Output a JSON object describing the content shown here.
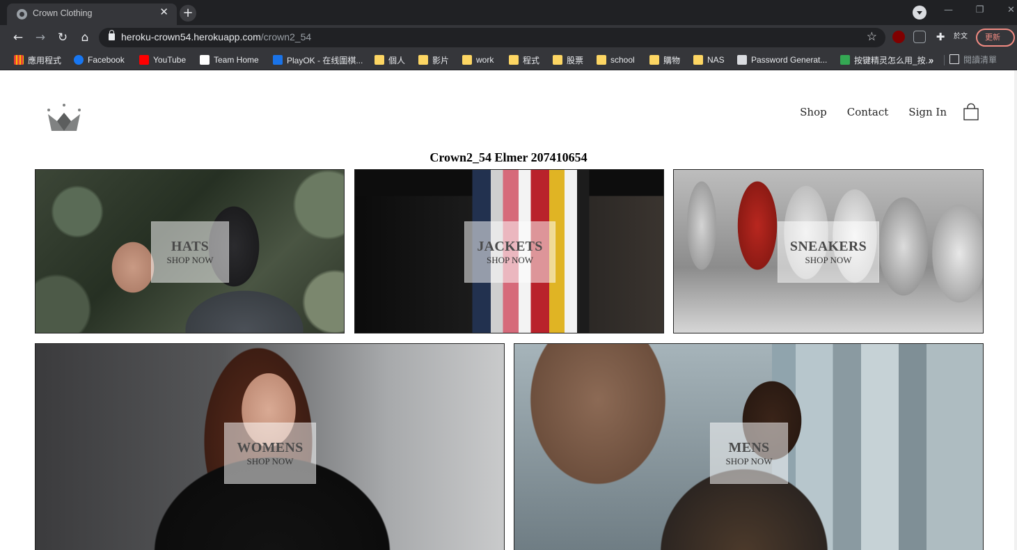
{
  "browser": {
    "tab_title": "Crown Clothing",
    "tab_close": "✕",
    "new_tab": "+",
    "url_domain": "heroku-crown54.herokuapp.com",
    "url_path": "/crown2_54",
    "update_button": "更新",
    "bookmarks": [
      {
        "label": "應用程式",
        "icon": "apps-icon"
      },
      {
        "label": "Facebook",
        "icon": "facebook-icon"
      },
      {
        "label": "YouTube",
        "icon": "youtube-icon"
      },
      {
        "label": "Team Home",
        "icon": "notion-icon"
      },
      {
        "label": "PlayOK - 在线圍棋...",
        "icon": "playok-icon"
      },
      {
        "label": "個人",
        "icon": "folder-icon"
      },
      {
        "label": "影片",
        "icon": "folder-icon"
      },
      {
        "label": "work",
        "icon": "folder-icon"
      },
      {
        "label": "程式",
        "icon": "folder-icon"
      },
      {
        "label": "股票",
        "icon": "folder-icon"
      },
      {
        "label": "school",
        "icon": "folder-icon"
      },
      {
        "label": "購物",
        "icon": "folder-icon"
      },
      {
        "label": "NAS",
        "icon": "folder-icon"
      },
      {
        "label": "Password Generat...",
        "icon": "page-icon"
      },
      {
        "label": "按键精灵怎么用_按...",
        "icon": "page-icon"
      }
    ],
    "bookmarks_more": "»",
    "reading_list_label": "閱讀清單"
  },
  "header": {
    "nav": {
      "shop": "Shop",
      "contact": "Contact",
      "sign_in": "Sign In"
    }
  },
  "page_title": "Crown2_54 Elmer 207410654",
  "categories": [
    {
      "title": "HATS",
      "subtitle": "SHOP NOW"
    },
    {
      "title": "JACKETS",
      "subtitle": "SHOP NOW"
    },
    {
      "title": "SNEAKERS",
      "subtitle": "SHOP NOW"
    },
    {
      "title": "WOMENS",
      "subtitle": "SHOP NOW"
    },
    {
      "title": "MENS",
      "subtitle": "SHOP NOW"
    }
  ],
  "colors": {
    "chrome_dark": "#202124",
    "chrome_toolbar": "#35363a",
    "update_accent": "#f28b82",
    "label_box": "rgba(255,255,255,0.52)"
  }
}
